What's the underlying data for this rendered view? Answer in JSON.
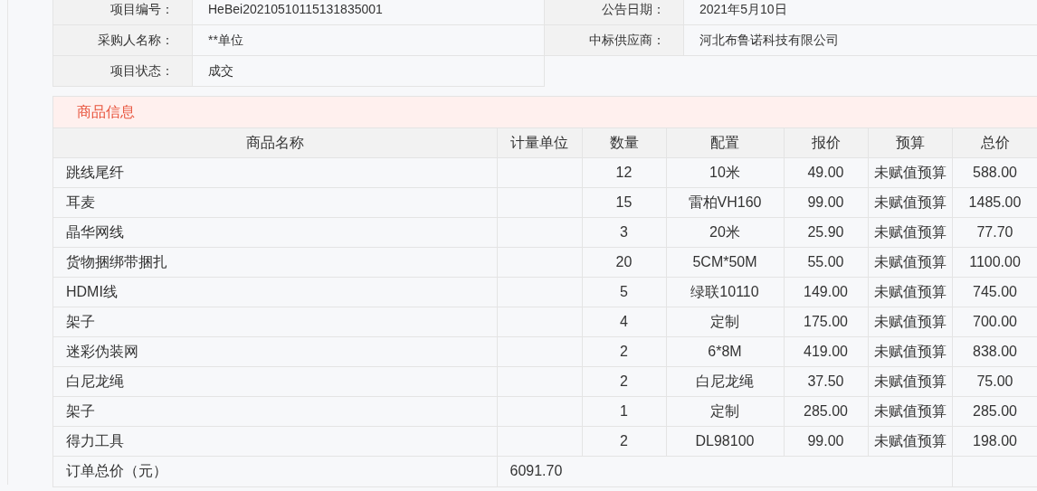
{
  "project_info": [
    {
      "label": "项目编号：",
      "value": "HeBei20210510115131835001"
    },
    {
      "label": "公告日期：",
      "value": "2021年5月10日"
    },
    {
      "label": "采购人名称：",
      "value": "**单位"
    },
    {
      "label": "中标供应商：",
      "value": "河北布鲁诺科技有限公司"
    },
    {
      "label": "项目状态：",
      "value": "成交"
    }
  ],
  "goods": {
    "title": "商品信息",
    "table": {
      "columns": [
        "商品名称",
        "计量单位",
        "数量",
        "配置",
        "报价",
        "预算",
        "总价"
      ],
      "rows": [
        [
          "跳线尾纤",
          "",
          "12",
          "10米",
          "49.00",
          "未赋值预算",
          "588.00"
        ],
        [
          "耳麦",
          "",
          "15",
          "雷柏VH160",
          "99.00",
          "未赋值预算",
          "1485.00"
        ],
        [
          "晶华网线",
          "",
          "3",
          "20米",
          "25.90",
          "未赋值预算",
          "77.70"
        ],
        [
          "货物捆绑带捆扎",
          "",
          "20",
          "5CM*50M",
          "55.00",
          "未赋值预算",
          "1100.00"
        ],
        [
          "HDMI线",
          "",
          "5",
          "绿联10110",
          "149.00",
          "未赋值预算",
          "745.00"
        ],
        [
          "架子",
          "",
          "4",
          "定制",
          "175.00",
          "未赋值预算",
          "700.00"
        ],
        [
          "迷彩伪装网",
          "",
          "2",
          "6*8M",
          "419.00",
          "未赋值预算",
          "838.00"
        ],
        [
          "白尼龙绳",
          "",
          "2",
          "白尼龙绳",
          "37.50",
          "未赋值预算",
          "75.00"
        ],
        [
          "架子",
          "",
          "1",
          "定制",
          "285.00",
          "未赋值预算",
          "285.00"
        ],
        [
          "得力工具",
          "",
          "2",
          "DL98100",
          "99.00",
          "未赋值预算",
          "198.00"
        ]
      ],
      "total": {
        "label": "订单总价（元）",
        "value": "6091.70"
      }
    }
  }
}
